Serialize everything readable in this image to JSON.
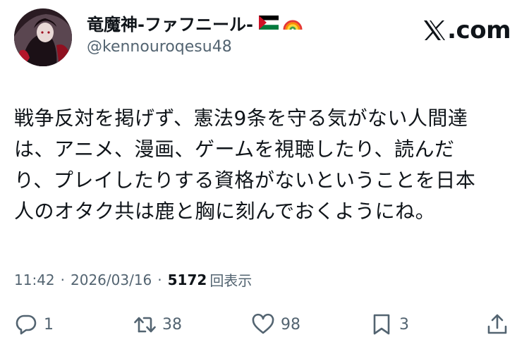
{
  "header": {
    "display_name": "竜魔神-ファフニール-",
    "flag_icon": "palestine-flag-icon",
    "emoji_icon": "rainbow-icon",
    "handle": "@kennouroqesu48",
    "brand_text": ".com"
  },
  "tweet": {
    "text": "戦争反対を掲げず、憲法9条を守る気がない人間達\nは、アニメ、漫画、ゲームを視聴したり、読んだ\nり、プレイしたりする資格がないということを日本\n人のオタク共は鹿と胸に刻んでおくようにね。"
  },
  "meta": {
    "time": "11:42",
    "separator": "·",
    "date": "2026/03/16",
    "views": "5172",
    "views_label": "回表示"
  },
  "actions": {
    "replies": "1",
    "retweets": "38",
    "likes": "98",
    "bookmarks": "3"
  },
  "colors": {
    "text": "#0f1419",
    "secondary": "#536471",
    "flag_red": "#ce1126",
    "flag_green": "#007a3d"
  }
}
